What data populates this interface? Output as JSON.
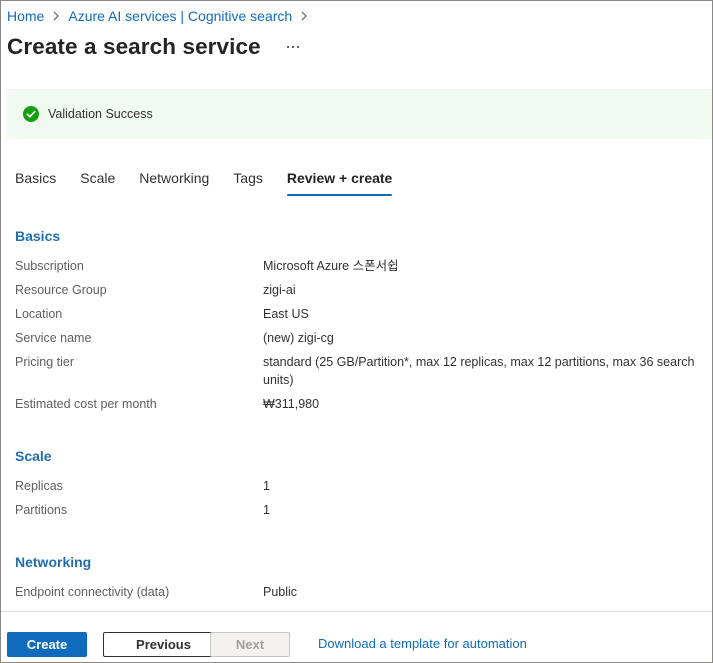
{
  "breadcrumb": {
    "items": [
      "Home",
      "Azure AI services | Cognitive search"
    ]
  },
  "page": {
    "title": "Create a search service",
    "more_icon": "more-ellipsis-icon"
  },
  "banner": {
    "text": "Validation Success",
    "icon": "success-check-icon",
    "color": "#13a10e",
    "background": "#f1faf1"
  },
  "tabs": {
    "items": [
      "Basics",
      "Scale",
      "Networking",
      "Tags",
      "Review + create"
    ],
    "active": "Review + create"
  },
  "basics": {
    "heading": "Basics",
    "rows": [
      {
        "label": "Subscription",
        "value": "Microsoft Azure 스폰서쉽"
      },
      {
        "label": "Resource Group",
        "value": "zigi-ai"
      },
      {
        "label": "Location",
        "value": "East US"
      },
      {
        "label": "Service name",
        "value": "(new) zigi-cg"
      },
      {
        "label": "Pricing tier",
        "value": "standard (25 GB/Partition*, max 12 replicas, max 12 partitions, max 36 search units)"
      },
      {
        "label": "Estimated cost per month",
        "value": "₩311,980"
      }
    ]
  },
  "scale": {
    "heading": "Scale",
    "rows": [
      {
        "label": "Replicas",
        "value": "1"
      },
      {
        "label": "Partitions",
        "value": "1"
      }
    ]
  },
  "networking": {
    "heading": "Networking",
    "rows": [
      {
        "label": "Endpoint connectivity (data)",
        "value": "Public"
      }
    ]
  },
  "footer": {
    "create_label": "Create",
    "previous_label": "Previous",
    "next_label": "Next",
    "template_link": "Download a template for automation"
  },
  "colors": {
    "accent": "#0f6cbd",
    "section_heading": "#1f6faf"
  }
}
